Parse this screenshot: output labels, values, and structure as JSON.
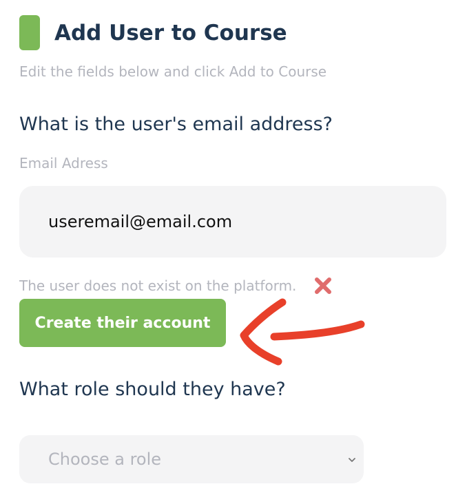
{
  "header": {
    "title": "Add User to Course",
    "subtitle": "Edit the fields below and click Add to Course"
  },
  "email_section": {
    "question": "What is the user's email address?",
    "field_label": "Email Adress",
    "value": "useremail@email.com",
    "error_text": "The user does not exist on the platform.",
    "error_icon": "close-icon"
  },
  "create_account": {
    "label": "Create their account"
  },
  "role_section": {
    "question": "What role should they have?",
    "select_value": "Choose a role",
    "select_icon": "chevron-down-icon"
  },
  "colors": {
    "accent": "#7cb957",
    "title": "#1f3650",
    "muted": "#b3b5bd",
    "field_bg": "#f4f4f5",
    "error_icon": "#e06c6c",
    "annotation_arrow": "#e8402a"
  }
}
